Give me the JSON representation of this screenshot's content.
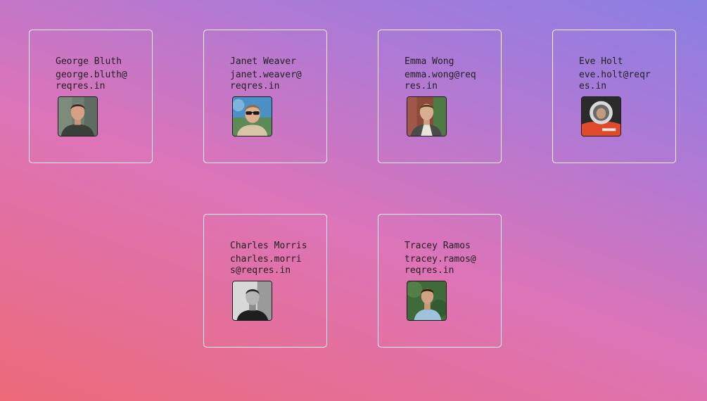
{
  "users": [
    {
      "name": "George Bluth",
      "email": "george.bluth@reqres.in",
      "avatar_icon": "george-avatar-photo"
    },
    {
      "name": "Janet Weaver",
      "email": "janet.weaver@reqres.in",
      "avatar_icon": "janet-avatar-photo"
    },
    {
      "name": "Emma Wong",
      "email": "emma.wong@reqres.in",
      "avatar_icon": "emma-avatar-photo"
    },
    {
      "name": "Eve Holt",
      "email": "eve.holt@reqres.in",
      "avatar_icon": "eve-avatar-photo"
    },
    {
      "name": "Charles Morris",
      "email": "charles.morris@reqres.in",
      "avatar_icon": "charles-avatar-photo"
    },
    {
      "name": "Tracey Ramos",
      "email": "tracey.ramos@reqres.in",
      "avatar_icon": "tracey-avatar-photo"
    }
  ],
  "colors": {
    "gradient_start": "#ec6a78",
    "gradient_mid": "#dd74b8",
    "gradient_end": "#8a7fe3",
    "card_border": "#ffffff",
    "text": "#222222"
  }
}
